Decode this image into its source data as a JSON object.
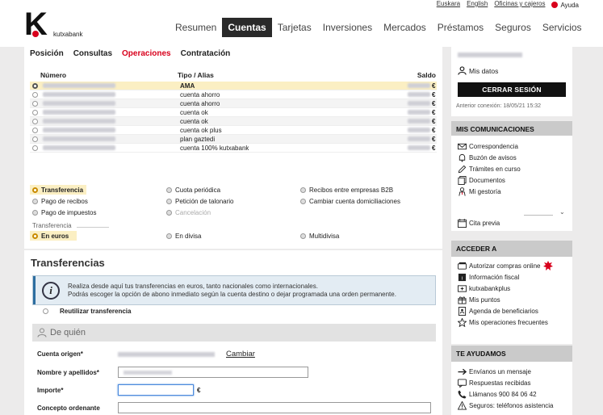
{
  "toplinks": {
    "euskara": "Euskara",
    "english": "English",
    "branches": "Oficinas y cajeros",
    "help": "Ayuda"
  },
  "logo": {
    "letter": "K",
    "text": "kutxabank"
  },
  "mainnav": {
    "items": [
      {
        "label": "Resumen",
        "active": false
      },
      {
        "label": "Cuentas",
        "active": true
      },
      {
        "label": "Tarjetas",
        "active": false
      },
      {
        "label": "Inversiones",
        "active": false
      },
      {
        "label": "Mercados",
        "active": false
      },
      {
        "label": "Préstamos",
        "active": false
      },
      {
        "label": "Seguros",
        "active": false
      },
      {
        "label": "Servicios",
        "active": false
      }
    ]
  },
  "subtabs": {
    "items": [
      {
        "label": "Posición",
        "active": false
      },
      {
        "label": "Consultas",
        "active": false
      },
      {
        "label": "Operaciones",
        "active": true
      },
      {
        "label": "Contratación",
        "active": false
      }
    ]
  },
  "accounts": {
    "headers": {
      "number": "Número",
      "type": "Tipo / Alias",
      "balance": "Saldo"
    },
    "currency": "€",
    "rows": [
      {
        "type": "AMA",
        "selected": true
      },
      {
        "type": "cuenta ahorro",
        "selected": false
      },
      {
        "type": "cuenta ahorro",
        "selected": false
      },
      {
        "type": "cuenta ok",
        "selected": false
      },
      {
        "type": "cuenta ok",
        "selected": false
      },
      {
        "type": "cuenta ok plus",
        "selected": false
      },
      {
        "type": "plan gaztedi",
        "selected": false
      },
      {
        "type": "cuenta 100% kutxabank",
        "selected": false
      }
    ]
  },
  "operations": {
    "options": [
      {
        "label": "Transferencia",
        "selected": true,
        "disabled": false
      },
      {
        "label": "Cuota periódica",
        "selected": false,
        "disabled": false
      },
      {
        "label": "Recibos entre empresas B2B",
        "selected": false,
        "disabled": false
      },
      {
        "label": "Pago de recibos",
        "selected": false,
        "disabled": false
      },
      {
        "label": "Petición de talonario",
        "selected": false,
        "disabled": false
      },
      {
        "label": "Cambiar cuenta domiciliaciones",
        "selected": false,
        "disabled": false
      },
      {
        "label": "Pago de impuestos",
        "selected": false,
        "disabled": false
      },
      {
        "label": "Cancelación",
        "selected": false,
        "disabled": true
      }
    ],
    "transfer_label": "Transferencia",
    "transfer_kinds": [
      {
        "label": "En euros",
        "selected": true
      },
      {
        "label": "En divisa",
        "selected": false
      },
      {
        "label": "Multidivisa",
        "selected": false
      }
    ]
  },
  "form": {
    "title": "Transferencias",
    "info_line1": "Realiza desde aquí tus transferencias en euros, tanto nacionales como internacionales.",
    "info_line2": "Podrás escoger la opción de abono inmediato según la cuenta destino o dejar programada una orden permanente.",
    "reuse_label": "Reutilizar transferencia",
    "section_label": "De quién",
    "origin_label": "Cuenta origen*",
    "change_link": "Cambiar",
    "name_label": "Nombre y apellidos*",
    "amount_label": "Importe*",
    "amount_value": "",
    "currency": "€",
    "concept_label": "Concepto ordenante",
    "concept_value": ""
  },
  "sidebar": {
    "my_data": "Mis datos",
    "logout": "CERRAR SESIÓN",
    "last_connection": "Anterior conexión: 18/05/21 15:32",
    "communications": {
      "title": "MIS COMUNICACIONES",
      "items": [
        {
          "label": "Correspondencia",
          "icon": "envelope-icon"
        },
        {
          "label": "Buzón de avisos",
          "icon": "bell-icon"
        },
        {
          "label": "Trámites en curso",
          "icon": "pencil-icon"
        },
        {
          "label": "Documentos",
          "icon": "documents-icon"
        },
        {
          "label": "Mi gestoría",
          "icon": "advisor-icon"
        }
      ],
      "appointment": {
        "label": "Cita previa",
        "icon": "calendar-icon"
      }
    },
    "access": {
      "title": "ACCEDER A",
      "items": [
        {
          "label": "Autorizar compras online",
          "icon": "card-icon",
          "badge": "new-badge-icon"
        },
        {
          "label": "Información fiscal",
          "icon": "tax-info-icon"
        },
        {
          "label": "kutxabankplus",
          "icon": "plus-card-icon"
        },
        {
          "label": "Mis puntos",
          "icon": "gift-icon"
        },
        {
          "label": "Agenda de beneficiarios",
          "icon": "contacts-icon"
        },
        {
          "label": "Mis operaciones frecuentes",
          "icon": "star-icon"
        }
      ]
    },
    "help": {
      "title": "TE AYUDAMOS",
      "items": [
        {
          "label": "Envíanos un mensaje",
          "icon": "send-icon"
        },
        {
          "label": "Respuestas recibidas",
          "icon": "chat-icon"
        },
        {
          "label": "Llámanos 900 84 06 42",
          "icon": "phone-icon"
        },
        {
          "label": "Seguros: teléfonos asistencia",
          "icon": "warning-icon"
        }
      ]
    }
  },
  "colors": {
    "accent": "#d8001c",
    "nav_active": "#2a2a2a",
    "selection": "#fbefc3",
    "info_bg": "#e3ecf3"
  }
}
